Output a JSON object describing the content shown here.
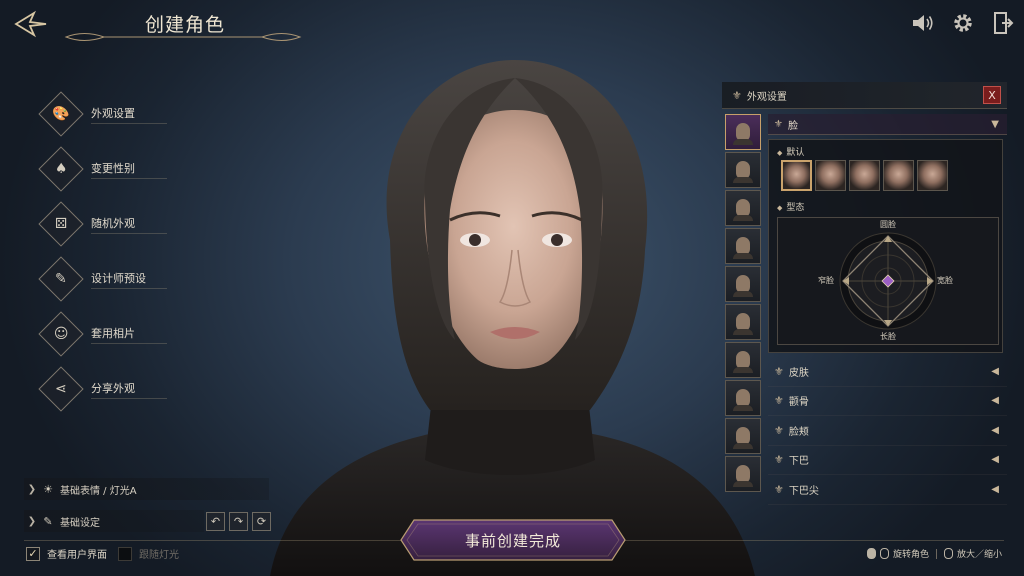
{
  "header": {
    "title": "创建角色"
  },
  "top_icons": [
    "speaker-icon",
    "gear-icon",
    "exit-door-icon"
  ],
  "left_menu": [
    {
      "label": "外观设置",
      "icon": "palette-icon"
    },
    {
      "label": "变更性别",
      "icon": "gender-cards-icon"
    },
    {
      "label": "随机外观",
      "icon": "dice-icon"
    },
    {
      "label": "设计师预设",
      "icon": "designer-cards-icon"
    },
    {
      "label": "套用相片",
      "icon": "photo-icon"
    },
    {
      "label": "分享外观",
      "icon": "share-icon"
    }
  ],
  "bottom_left": {
    "expression_label": "基础表情 / 灯光A",
    "basic_label": "基础设定",
    "show_ui_label": "查看用户界面",
    "show_ui_checked": true,
    "follow_light_label": "跟随灯光",
    "follow_light_checked": false
  },
  "complete_button": {
    "label": "事前创建完成"
  },
  "bottom_right": {
    "rotate_label": "旋转角色",
    "zoom_label": "放大／缩小"
  },
  "panel": {
    "title": "外观设置",
    "close_label": "X",
    "presets_selected_index": 0,
    "preset_count": 10,
    "face": {
      "label": "脸",
      "default_label": "默认",
      "thumb_count": 5,
      "thumb_selected_index": 0,
      "shape_label": "型态",
      "radar": {
        "top": "圆脸",
        "left": "窄脸",
        "right": "宽脸",
        "bottom": "长脸"
      }
    },
    "categories": [
      "皮肤",
      "颧骨",
      "脸颊",
      "下巴",
      "下巴尖"
    ]
  },
  "colors": {
    "accent_gold": "#c9b79a",
    "complete_purple": "#4a2a5c",
    "selected_preset": "#4b2e5a",
    "close_red": "#7a1d1d",
    "background": "#2b3b4f"
  }
}
